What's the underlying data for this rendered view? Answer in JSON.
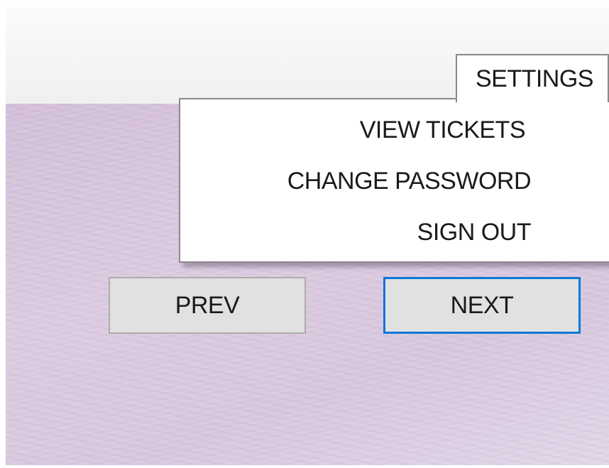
{
  "menu": {
    "settings_label": "SETTINGS",
    "items": [
      {
        "label": "VIEW TICKETS"
      },
      {
        "label": "CHANGE PASSWORD"
      },
      {
        "label": "SIGN OUT"
      }
    ]
  },
  "navigation": {
    "prev_label": "PREV",
    "next_label": "NEXT"
  },
  "colors": {
    "focus_border": "#0a78d7",
    "background_tint": "#d8c7de"
  }
}
